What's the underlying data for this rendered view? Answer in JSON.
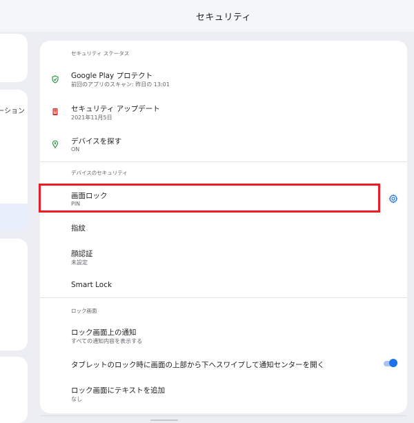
{
  "topbar": {
    "title": "セキュリティ"
  },
  "left_pane": {
    "partial_text": "ーション"
  },
  "sections": {
    "status": {
      "header": "セキュリティ ステータス",
      "google_play": {
        "title": "Google Play プロテクト",
        "subtitle": "前回のアプリのスキャン: 昨日の 13:01"
      },
      "security_update": {
        "title": "セキュリティ アップデート",
        "subtitle": "2021年11月5日"
      },
      "find_device": {
        "title": "デバイスを探す",
        "subtitle": "ON"
      }
    },
    "device": {
      "header": "デバイスのセキュリティ",
      "screen_lock": {
        "title": "画面ロック",
        "subtitle": "PIN"
      },
      "fingerprint": {
        "title": "指紋"
      },
      "face": {
        "title": "顔認証",
        "subtitle": "未設定"
      },
      "smart_lock": {
        "title": "Smart Lock"
      }
    },
    "lock_screen": {
      "header": "ロック画面",
      "notifications": {
        "title": "ロック画面上の通知",
        "subtitle": "すべての通知内容を表示する"
      },
      "swipe_down": {
        "title": "タブレットのロック時に画面の上部から下へスワイプして通知センターを開く",
        "enabled": true
      },
      "add_text": {
        "title": "ロック画面にテキストを追加",
        "subtitle": "なし"
      }
    }
  },
  "colors": {
    "accent": "#1a73e8",
    "highlight": "#ee1b24",
    "shield_green": "#1e8e3e",
    "update_red": "#d93025"
  },
  "icons": {
    "google_play": "shield-check-icon",
    "security_update": "phone-update-icon",
    "find_device": "location-pin-icon",
    "screen_lock_settings": "gear-icon"
  }
}
